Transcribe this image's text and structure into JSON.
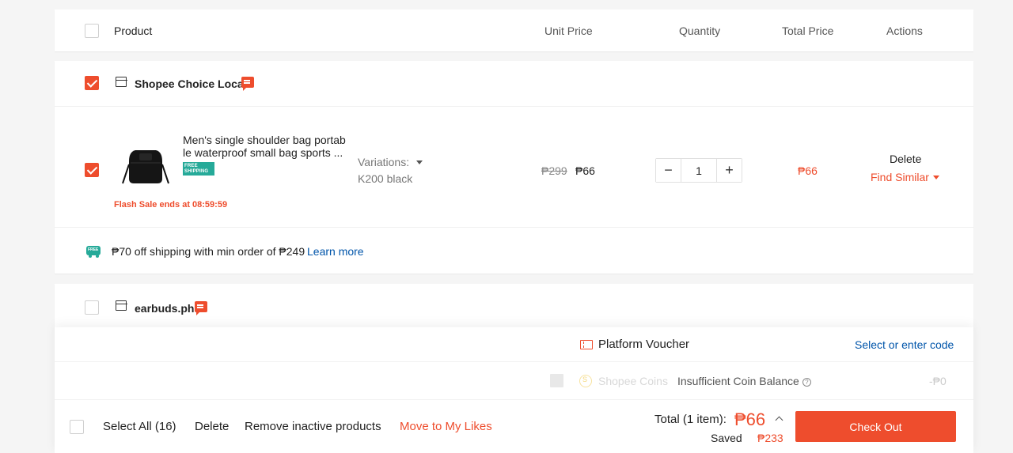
{
  "header": {
    "product": "Product",
    "unit_price": "Unit Price",
    "quantity": "Quantity",
    "total_price": "Total Price",
    "actions": "Actions"
  },
  "shops": [
    {
      "name": "Shopee Choice Local",
      "checked": true,
      "items": [
        {
          "name_line1": "Men's single shoulder bag portab",
          "name_line2": "le waterproof small bag sports ...",
          "badge": "FREE SHIPPING",
          "flash_sale": "Flash Sale ends at 08:59:59",
          "variations_label": "Variations:",
          "variation_value": "K200 black",
          "original_price": "₱299",
          "price": "₱66",
          "quantity": "1",
          "total": "₱66",
          "delete": "Delete",
          "find_similar": "Find Similar"
        }
      ],
      "shipping_text": "₱70 off shipping with min order of ₱249",
      "learn_more": "Learn more"
    },
    {
      "name": "earbuds.ph",
      "checked": false
    }
  ],
  "footer": {
    "platform_voucher": "Platform Voucher",
    "select_code": "Select or enter code",
    "shopee_coins": "Shopee Coins",
    "insufficient": "Insufficient Coin Balance",
    "coins_value": "-₱0",
    "select_all": "Select All (16)",
    "delete": "Delete",
    "remove_inactive": "Remove inactive products",
    "move_to_likes": "Move to My Likes",
    "total_label": "Total (1 item):",
    "total_value": "₱66",
    "saved_label": "Saved",
    "saved_value": "₱233",
    "checkout": "Check Out"
  },
  "colors": {
    "accent": "#ee4d2d",
    "teal": "#26aa99",
    "link": "#05a"
  }
}
